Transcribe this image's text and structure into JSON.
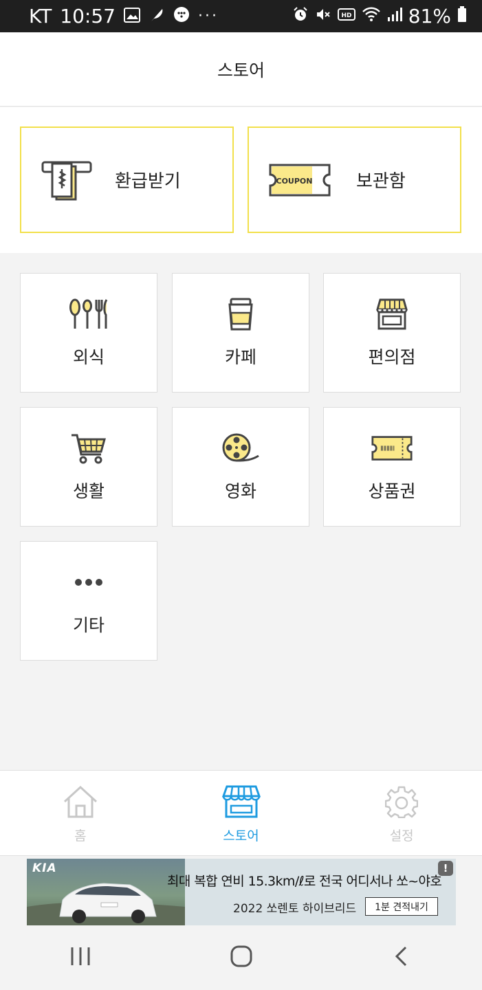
{
  "status_bar": {
    "carrier": "KT",
    "time": "10:57",
    "battery": "81%",
    "more": "···",
    "left_icons": [
      "gallery-icon",
      "feather-app-icon",
      "messenger-icon"
    ],
    "right_icons": [
      "alarm-icon",
      "mute-icon",
      "hd-voice-icon",
      "wifi-icon",
      "signal-icon",
      "battery-icon"
    ]
  },
  "header": {
    "title": "스토어"
  },
  "actions": [
    {
      "label": "환급받기",
      "icon": "refund-receipt-icon"
    },
    {
      "label": "보관함",
      "icon": "coupon-icon",
      "coupon_text": "COUPON"
    }
  ],
  "categories": [
    {
      "label": "외식",
      "icon": "utensils-icon"
    },
    {
      "label": "카페",
      "icon": "coffee-cup-icon"
    },
    {
      "label": "편의점",
      "icon": "convenience-store-icon"
    },
    {
      "label": "생활",
      "icon": "shopping-cart-icon"
    },
    {
      "label": "영화",
      "icon": "film-reel-icon"
    },
    {
      "label": "상품권",
      "icon": "gift-voucher-icon"
    },
    {
      "label": "기타",
      "icon": "more-dots-icon"
    }
  ],
  "bottom_nav": [
    {
      "label": "홈",
      "icon": "home-icon",
      "active": false
    },
    {
      "label": "스토어",
      "icon": "store-icon",
      "active": true
    },
    {
      "label": "설정",
      "icon": "settings-gear-icon",
      "active": false
    }
  ],
  "ad": {
    "brand": "KIA",
    "headline": "최대 복합 연비 15.3km/ℓ로 전국 어디서나 쏘~야호",
    "sub": "2022 쏘렌토 하이브리드",
    "cta": "1분 견적내기",
    "info": "!"
  },
  "colors": {
    "accent_blue": "#1e9be0",
    "yellow_border": "#f2e04a",
    "icon_yellow": "#fbe98a",
    "icon_outline": "#444444",
    "inactive_nav": "#c7c7c7"
  }
}
